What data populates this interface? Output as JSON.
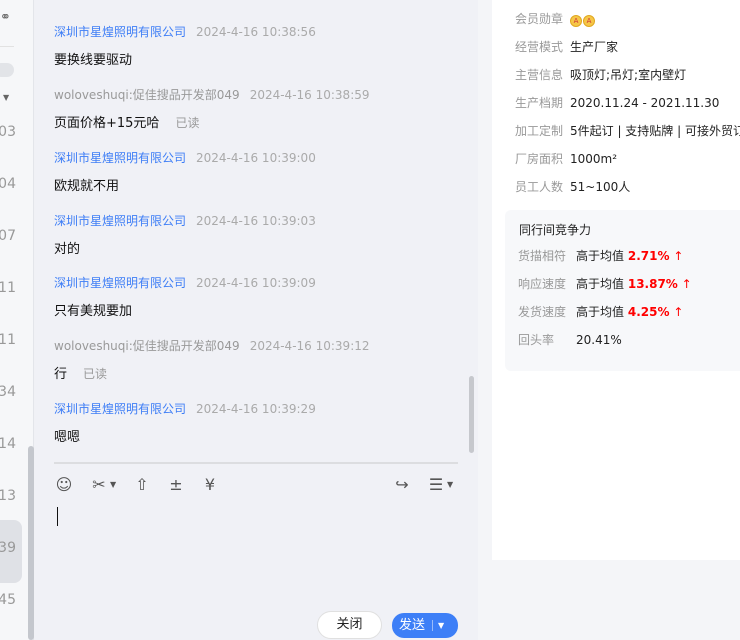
{
  "left_list": {
    "numbers": [
      "03",
      "04",
      "07",
      "11",
      "11",
      "34",
      "14",
      "13",
      "39",
      "45"
    ]
  },
  "messages": [
    {
      "sender": "深圳市星煌照明有限公司",
      "time": "2024-4-16 10:38:56",
      "text": "要换线要驱动",
      "role": "shop"
    },
    {
      "sender": "woloveshuqi:促佳搜品开发部049",
      "time": "2024-4-16 10:38:59",
      "text": "页面价格+15元哈",
      "role": "cust",
      "status": "已读"
    },
    {
      "sender": "深圳市星煌照明有限公司",
      "time": "2024-4-16 10:39:00",
      "text": "欧规就不用",
      "role": "shop"
    },
    {
      "sender": "深圳市星煌照明有限公司",
      "time": "2024-4-16 10:39:03",
      "text": "对的",
      "role": "shop"
    },
    {
      "sender": "深圳市星煌照明有限公司",
      "time": "2024-4-16 10:39:09",
      "text": "只有美规要加",
      "role": "shop"
    },
    {
      "sender": "woloveshuqi:促佳搜品开发部049",
      "time": "2024-4-16 10:39:12",
      "text": "行",
      "role": "cust",
      "status": "已读"
    },
    {
      "sender": "深圳市星煌照明有限公司",
      "time": "2024-4-16 10:39:29",
      "text": "嗯嗯",
      "role": "shop"
    }
  ],
  "composer": {
    "close_label": "关闭",
    "send_label": "发送",
    "input_value": ""
  },
  "profile": {
    "badge_label": "会员勋章",
    "rows": [
      {
        "k": "经营模式",
        "v": "生产厂家"
      },
      {
        "k": "主营信息",
        "v": "吸顶灯;吊灯;室内壁灯"
      },
      {
        "k": "生产档期",
        "v": "2020.11.24 - 2021.11.30"
      },
      {
        "k": "加工定制",
        "v": "5件起订 | 支持贴牌 | 可接外贸订"
      },
      {
        "k": "厂房面积",
        "v": "1000m²"
      },
      {
        "k": "员工人数",
        "v": "51~100人"
      }
    ]
  },
  "competition": {
    "title": "同行间竞争力",
    "rows": [
      {
        "k": "货描相符",
        "v": "高于均值",
        "pct": "2.71%",
        "arrow": "↑"
      },
      {
        "k": "响应速度",
        "v": "高于均值",
        "pct": "13.87%",
        "arrow": "↑"
      },
      {
        "k": "发货速度",
        "v": "高于均值",
        "pct": "4.25%",
        "arrow": "↑"
      }
    ],
    "repeat": {
      "k": "回头率",
      "v": "20.41%"
    }
  },
  "colors": {
    "accent": "#3d7ff7",
    "up": "#ff0000"
  }
}
